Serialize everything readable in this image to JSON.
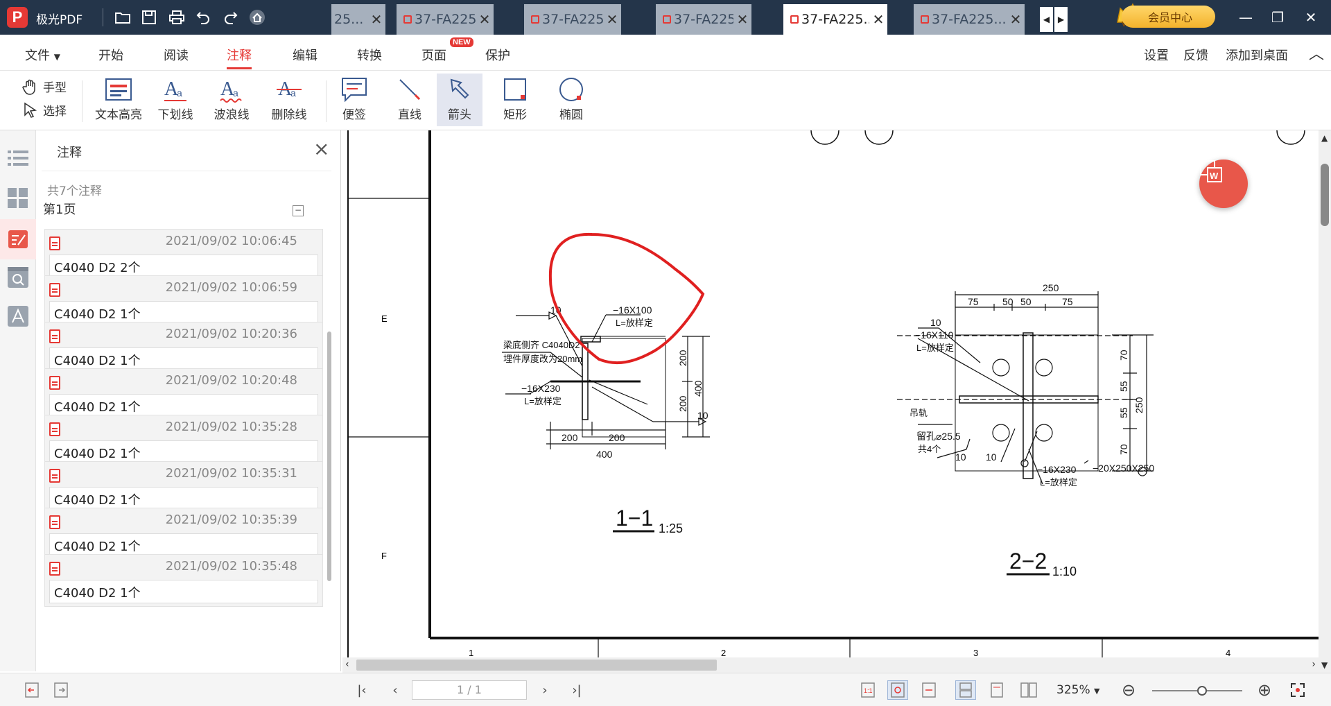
{
  "app": {
    "name": "极光PDF",
    "logo_letter": "P"
  },
  "tabs": [
    {
      "label": "25...",
      "active": false
    },
    {
      "label": "37-FA225...",
      "active": false
    },
    {
      "label": "37-FA225...",
      "active": false
    },
    {
      "label": "37-FA225...",
      "active": false
    },
    {
      "label": "37-FA225...",
      "active": true
    },
    {
      "label": "37-FA225...",
      "active": false
    }
  ],
  "tab_close": "✕",
  "vip_label": "会员中心",
  "menu": {
    "items": [
      "文件",
      "开始",
      "阅读",
      "注释",
      "编辑",
      "转换",
      "页面",
      "保护"
    ],
    "active": "注释",
    "new_badge": "NEW",
    "right_items": [
      "设置",
      "反馈",
      "添加到桌面"
    ]
  },
  "toolbar": {
    "hand": "手型",
    "select": "选择",
    "tools": [
      "文本高亮",
      "下划线",
      "波浪线",
      "删除线",
      "便签",
      "直线",
      "箭头",
      "矩形",
      "椭圆"
    ],
    "selected": "箭头"
  },
  "panel": {
    "title": "注释",
    "count": "共7个注释",
    "page": "第1页",
    "collapse": "−",
    "cards": [
      {
        "time": "2021/09/02 10:06:45",
        "text": "C4040 D2  2个"
      },
      {
        "time": "2021/09/02 10:06:59",
        "text": "C4040 D2  1个"
      },
      {
        "time": "2021/09/02 10:20:36",
        "text": "C4040 D2 1个"
      },
      {
        "time": "2021/09/02 10:20:48",
        "text": "C4040 D2 1个"
      },
      {
        "time": "2021/09/02 10:35:28",
        "text": "C4040 D2 1个"
      },
      {
        "time": "2021/09/02 10:35:31",
        "text": "C4040 D2 1个"
      },
      {
        "time": "2021/09/02 10:35:39",
        "text": "C4040 D2 1个"
      },
      {
        "time": "2021/09/02 10:35:48",
        "text": "C4040 D2 1个"
      }
    ]
  },
  "drawing": {
    "grid_rows": [
      "E",
      "F"
    ],
    "grid_cols": [
      "1",
      "2",
      "3",
      "4"
    ],
    "sec1": {
      "dim_10a": "10",
      "plate_top": "−16X100",
      "plate_top_l": "L=放样定",
      "beam_note1": "梁底侧齐 C4040D2",
      "beam_note2": "埋件厚度改为20mm",
      "plate_bot": "−16X230",
      "plate_bot_l": "L=放样定",
      "dim_200a": "200",
      "dim_200b": "200",
      "dim_400v": "400",
      "dim_200c": "200",
      "dim_200d": "200",
      "dim_400h": "400",
      "dim_10b": "10",
      "title": "1−1",
      "scale": "1:25"
    },
    "sec2": {
      "dim_250": "250",
      "d75a": "75",
      "d50a": "50",
      "d50b": "50",
      "d75b": "75",
      "dim_10a": "10",
      "plate_a": "−16X110",
      "plate_a_l": "L=放样定",
      "rail": "吊轨",
      "hole": "留孔⌀25.5",
      "hole_n": "共4个",
      "d10b": "10",
      "d10c": "10",
      "plate_b": "−16X230",
      "plate_b_l": "L=放样定",
      "plate_c": "−20X250X250",
      "v70a": "70",
      "v55a": "55",
      "v55b": "55",
      "v70b": "70",
      "v250": "250",
      "title": "2−2",
      "scale": "1:10"
    }
  },
  "status": {
    "page": "1 / 1",
    "zoom": "325%",
    "zoom_level": 0.55
  },
  "colors": {
    "titlebar": "#24354a",
    "accent": "#e53935",
    "annotation": "#e02020"
  }
}
